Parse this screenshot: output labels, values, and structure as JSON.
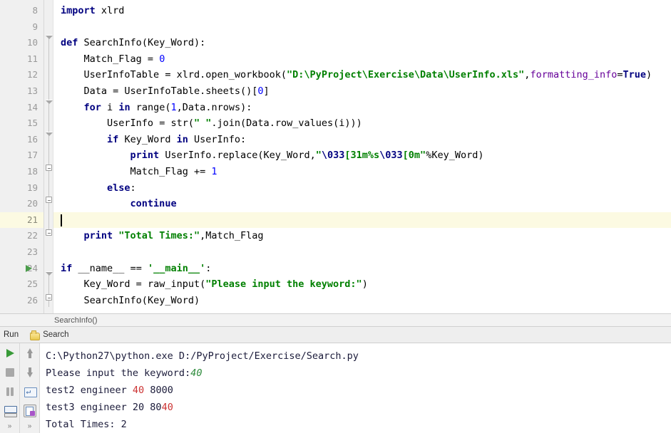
{
  "editor": {
    "first_line_number": 8,
    "current_line_number": 21,
    "run_marker_line": 24,
    "lines": [
      {
        "num": "8",
        "text": "import xlrd"
      },
      {
        "num": "9",
        "text": ""
      },
      {
        "num": "10",
        "text": "def SearchInfo(Key_Word):"
      },
      {
        "num": "11",
        "text": "    Match_Flag = 0"
      },
      {
        "num": "12",
        "text": "    UserInfoTable = xlrd.open_workbook(\"D:\\PyProject\\Exercise\\Data\\UserInfo.xls\",formatting_info=True)"
      },
      {
        "num": "13",
        "text": "    Data = UserInfoTable.sheets()[0]"
      },
      {
        "num": "14",
        "text": "    for i in range(1,Data.nrows):"
      },
      {
        "num": "15",
        "text": "        UserInfo = str(\" \".join(Data.row_values(i)))"
      },
      {
        "num": "16",
        "text": "        if Key_Word in UserInfo:"
      },
      {
        "num": "17",
        "text": "            print UserInfo.replace(Key_Word,\"\\033[31m%s\\033[0m\"%Key_Word)"
      },
      {
        "num": "18",
        "text": "            Match_Flag += 1"
      },
      {
        "num": "19",
        "text": "        else:"
      },
      {
        "num": "20",
        "text": "            continue"
      },
      {
        "num": "21",
        "text": ""
      },
      {
        "num": "22",
        "text": "    print \"Total Times:\",Match_Flag"
      },
      {
        "num": "23",
        "text": ""
      },
      {
        "num": "24",
        "text": "if __name__ == '__main__':"
      },
      {
        "num": "25",
        "text": "    Key_Word = raw_input(\"Please input the keyword:\")"
      },
      {
        "num": "26",
        "text": "    SearchInfo(Key_Word)"
      }
    ]
  },
  "breadcrumb": {
    "path": "SearchInfo()"
  },
  "toolwindow": {
    "label": "Run",
    "tab_label": "Search",
    "tab_icon": "run-config-icon",
    "left_toolbar": [
      {
        "name": "rerun-button",
        "icon": "run-icon"
      },
      {
        "name": "stop-button",
        "icon": "stop-icon"
      },
      {
        "name": "pause-button",
        "icon": "pause-icon"
      },
      {
        "name": "show-console-button",
        "icon": "console-icon"
      }
    ],
    "left_toolbar_more": "»",
    "right_toolbar": [
      {
        "name": "up-the-stack-button",
        "icon": "arrow-up-icon"
      },
      {
        "name": "down-the-stack-button",
        "icon": "arrow-down-icon"
      },
      {
        "name": "soft-wrap-button",
        "icon": "soft-wrap-icon"
      },
      {
        "name": "scroll-to-end-button",
        "icon": "scroll-to-end-icon"
      }
    ],
    "right_toolbar_more": "»"
  },
  "console": {
    "lines": [
      {
        "name": "console-command-line",
        "segments": [
          {
            "text": "C:\\Python27\\python.exe D:/PyProject/Exercise/Search.py",
            "style": "plain"
          }
        ]
      },
      {
        "name": "console-prompt-line",
        "segments": [
          {
            "text": "Please input the keyword:",
            "style": "plain"
          },
          {
            "text": "40",
            "style": "input"
          }
        ]
      },
      {
        "name": "console-result-line-1",
        "segments": [
          {
            "text": "test2 engineer ",
            "style": "plain"
          },
          {
            "text": "40",
            "style": "highlight"
          },
          {
            "text": " 8000",
            "style": "plain"
          }
        ]
      },
      {
        "name": "console-result-line-2",
        "segments": [
          {
            "text": "test3 engineer 20 80",
            "style": "plain"
          },
          {
            "text": "40",
            "style": "highlight"
          }
        ]
      },
      {
        "name": "console-total-line",
        "segments": [
          {
            "text": "Total Times: 2",
            "style": "plain"
          }
        ]
      }
    ]
  },
  "colors": {
    "keyword": "#000080",
    "string": "#008000",
    "number": "#0000ff",
    "kwarg": "#660099",
    "current_line_bg": "#fcfae2",
    "gutter_bg": "#f0f0f0",
    "console_highlight": "#cc3333",
    "console_input": "#2e8b3c",
    "run_green": "#389a38"
  }
}
